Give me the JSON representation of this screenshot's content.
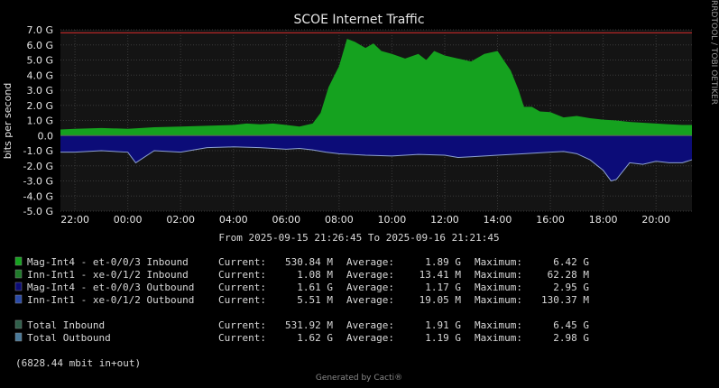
{
  "title": "SCOE Internet Traffic",
  "side_label": "RRDTOOL / TOBI OETIKER",
  "footer": "Generated by Cacti®",
  "range_text": "From 2025-09-15 21:26:45 To 2025-09-16 21:21:45",
  "total_text": "(6828.44 mbit in+out)",
  "colors": {
    "background": "#000000",
    "plot_bg": "#141414",
    "inbound": "#15a21f",
    "outbound": "#0c0c78",
    "outbound_line": "#8ea2d2",
    "threshold": "#d42a2a"
  },
  "legend_rows": [
    {
      "swatch": "#15a21f",
      "name": "Mag-Int4 - et-0/0/3 Inbound",
      "cur_label": "Current:",
      "cur": "530.84 M",
      "avg_label": "Average:",
      "avg": "1.89 G",
      "max_label": "Maximum:",
      "max": "6.42 G"
    },
    {
      "swatch": "#1f7a2a",
      "name": "Inn-Int1 - xe-0/1/2 Inbound",
      "cur_label": "Current:",
      "cur": "1.08 M",
      "avg_label": "Average:",
      "avg": "13.41 M",
      "max_label": "Maximum:",
      "max": "62.28 M"
    },
    {
      "swatch": "#0c0c78",
      "name": "Mag-Int4 - et-0/0/3 Outbound",
      "cur_label": "Current:",
      "cur": "1.61 G",
      "avg_label": "Average:",
      "avg": "1.17 G",
      "max_label": "Maximum:",
      "max": "2.95 G"
    },
    {
      "swatch": "#2a4aa8",
      "name": "Inn-Int1 - xe-0/1/2 Outbound",
      "cur_label": "Current:",
      "cur": "5.51 M",
      "avg_label": "Average:",
      "avg": "19.05 M",
      "max_label": "Maximum:",
      "max": "130.37 M"
    },
    {
      "swatch": "#2f5f4a",
      "name": "Total Inbound",
      "cur_label": "Current:",
      "cur": "531.92 M",
      "avg_label": "Average:",
      "avg": "1.91 G",
      "max_label": "Maximum:",
      "max": "6.45 G"
    },
    {
      "swatch": "#4a7a9a",
      "name": "Total Outbound",
      "cur_label": "Current:",
      "cur": "1.62 G",
      "avg_label": "Average:",
      "avg": "1.19 G",
      "max_label": "Maximum:",
      "max": "2.98 G"
    }
  ],
  "chart_data": {
    "type": "area",
    "title": "SCOE Internet Traffic",
    "ylabel": "bits per second",
    "ylim": [
      -5,
      7
    ],
    "y_unit": "G",
    "y_ticks": [
      7,
      6,
      5,
      4,
      3,
      2,
      1,
      0,
      -1,
      -2,
      -3,
      -4,
      -5
    ],
    "y_tick_labels": [
      "7.0 G",
      "6.0 G",
      "5.0 G",
      "4.0 G",
      "3.0 G",
      "2.0 G",
      "1.0 G",
      "0.0",
      "-1.0 G",
      "-2.0 G",
      "-3.0 G",
      "-4.0 G",
      "-5.0 G"
    ],
    "x_tick_labels": [
      "22:00",
      "00:00",
      "02:00",
      "04:00",
      "06:00",
      "08:00",
      "10:00",
      "12:00",
      "14:00",
      "16:00",
      "18:00",
      "20:00"
    ],
    "x_range_hours": [
      21.45,
      45.36
    ],
    "x_tick_hours": [
      22,
      24,
      26,
      28,
      30,
      32,
      34,
      36,
      38,
      40,
      42,
      44
    ],
    "threshold": 6.8,
    "grid": true,
    "series": [
      {
        "name": "Total Inbound",
        "x": [
          21.45,
          22,
          23,
          24,
          25,
          26,
          27,
          28,
          28.5,
          29,
          29.5,
          30,
          30.5,
          31,
          31.3,
          31.6,
          32,
          32.3,
          32.6,
          33,
          33.3,
          33.6,
          34,
          34.5,
          35,
          35.3,
          35.6,
          36,
          36.5,
          37,
          37.5,
          38,
          38.5,
          38.8,
          39,
          39.3,
          39.6,
          40,
          40.5,
          41,
          41.5,
          42,
          42.5,
          43,
          43.5,
          44,
          44.5,
          45,
          45.36
        ],
        "values": [
          0.4,
          0.45,
          0.5,
          0.45,
          0.55,
          0.6,
          0.65,
          0.7,
          0.8,
          0.75,
          0.8,
          0.7,
          0.6,
          0.8,
          1.5,
          3.2,
          4.6,
          6.4,
          6.2,
          5.8,
          6.1,
          5.6,
          5.4,
          5.1,
          5.4,
          5.0,
          5.6,
          5.3,
          5.1,
          4.9,
          5.4,
          5.6,
          4.3,
          3.0,
          1.9,
          1.9,
          1.6,
          1.55,
          1.2,
          1.3,
          1.15,
          1.05,
          1.0,
          0.9,
          0.85,
          0.8,
          0.75,
          0.7,
          0.7
        ]
      },
      {
        "name": "Total Outbound",
        "x": [
          21.45,
          22,
          23,
          24,
          24.3,
          25,
          26,
          27,
          28,
          29,
          30,
          30.5,
          31,
          31.5,
          32,
          32.5,
          33,
          34,
          35,
          36,
          36.5,
          37,
          38,
          39,
          40,
          40.5,
          41,
          41.5,
          42,
          42.3,
          42.5,
          43,
          43.5,
          44,
          44.5,
          45,
          45.36
        ],
        "values": [
          -1.1,
          -1.1,
          -1.0,
          -1.1,
          -1.8,
          -1.0,
          -1.1,
          -0.8,
          -0.75,
          -0.8,
          -0.9,
          -0.85,
          -0.95,
          -1.1,
          -1.2,
          -1.25,
          -1.3,
          -1.35,
          -1.25,
          -1.3,
          -1.45,
          -1.4,
          -1.3,
          -1.2,
          -1.1,
          -1.05,
          -1.2,
          -1.6,
          -2.3,
          -3.0,
          -2.9,
          -1.8,
          -1.9,
          -1.7,
          -1.8,
          -1.8,
          -1.6
        ]
      }
    ]
  }
}
